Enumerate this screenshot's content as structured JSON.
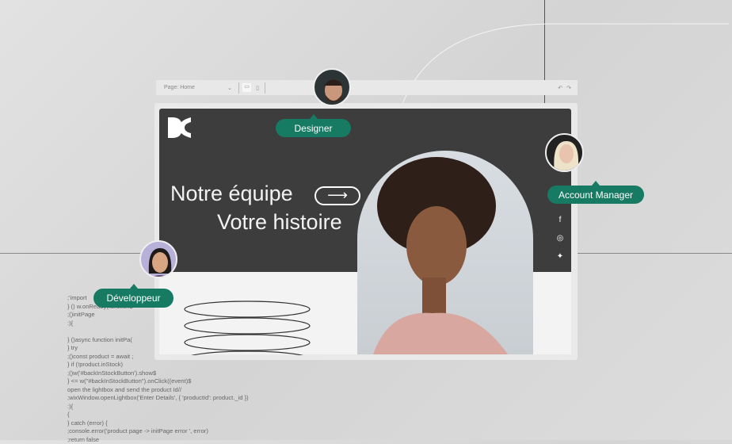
{
  "toolbar": {
    "page_select": "Page: Home",
    "desktop_icon": "desktop-icon",
    "mobile_icon": "mobile-icon",
    "undo_icon": "undo-icon",
    "redo_icon": "redo-icon"
  },
  "site": {
    "logo": "DC",
    "headline_1": "Notre équipe",
    "headline_2": "Votre histoire",
    "social": [
      "facebook-icon",
      "instagram-icon",
      "twitter-icon"
    ]
  },
  "collaborators": [
    {
      "role": "Designer"
    },
    {
      "role": "Account Manager"
    },
    {
      "role": "Développeur"
    }
  ],
  "code_lines": [
    ";'import",
    "} () w.onReady(function$",
    ";()initPage",
    ":){",
    "",
    "} ()async function initPa(",
    "} try",
    ";()const product = await ;",
    "} if (!product.inStock)",
    ";()w('#backInStockButton').show$",
    "} <= w(\"#backInStockButton\").onClick((event)$",
    "open the lightbox and send the product Id//",
    ";wixWindow.openLightbox('Enter Details', { 'productId': product._id })",
    ":){",
    "{",
    "} catch (error) {",
    ";console.error('product page -> initPage error ', error)",
    ";return false"
  ],
  "colors": {
    "accent": "#177a63",
    "dark": "#3d3d3d"
  }
}
